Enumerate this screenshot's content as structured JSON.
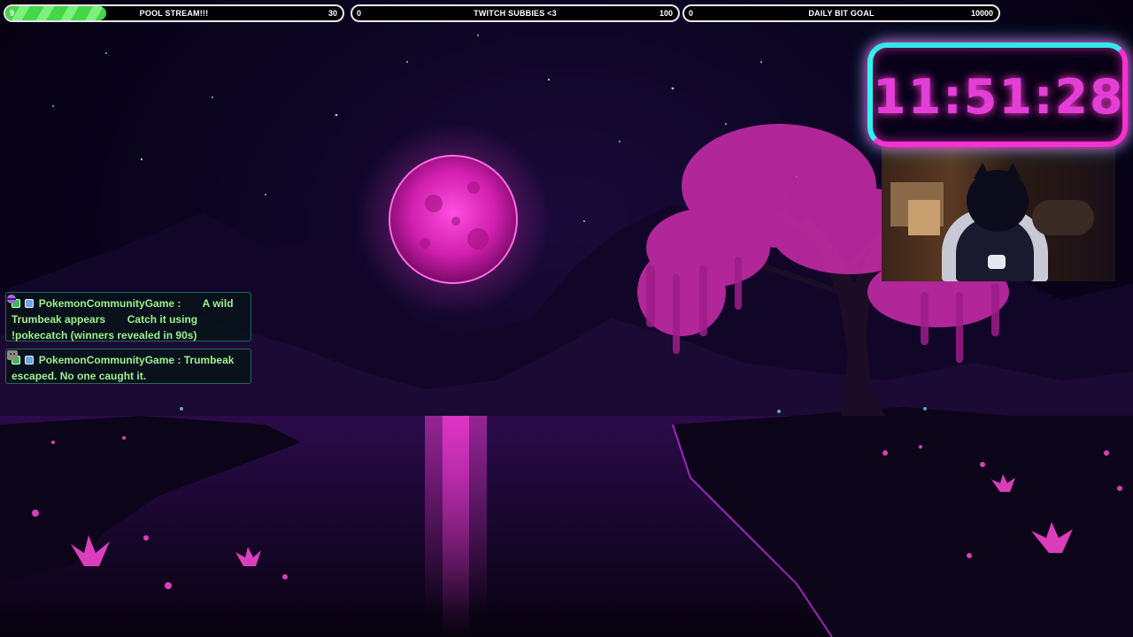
{
  "goals": [
    {
      "title": "POOL STREAM!!!",
      "current": "9",
      "target": "30",
      "progress": 0.3
    },
    {
      "title": "TWITCH SUBBIES <3",
      "current": "0",
      "target": "100",
      "progress": 0
    },
    {
      "title": "DAILY BIT GOAL",
      "current": "0",
      "target": "10000",
      "progress": 0
    }
  ],
  "timer": {
    "value": "11:51:28"
  },
  "chat": {
    "messages": [
      {
        "user": "PokemonCommunityGame",
        "separator": " :",
        "text_before": "A wild Trumbeak appears",
        "text_after": "Catch it using !pokecatch (winners revealed in 90s)",
        "emotes": [
          "pokeball-emote",
          "pokeball-emote"
        ]
      },
      {
        "user": "PokemonCommunityGame",
        "separator": " :",
        "text_before": "Trumbeak escaped. No one caught it.",
        "emotes": [
          "sad-emote"
        ]
      }
    ]
  },
  "colors": {
    "goal_fill": "#45d64a",
    "timer_text": "#e33ed6",
    "timer_border_pink": "#ff2fd0",
    "timer_border_cyan": "#2ff4ee",
    "chat_text": "#9ef28a",
    "moon": "#ff2fd0"
  }
}
